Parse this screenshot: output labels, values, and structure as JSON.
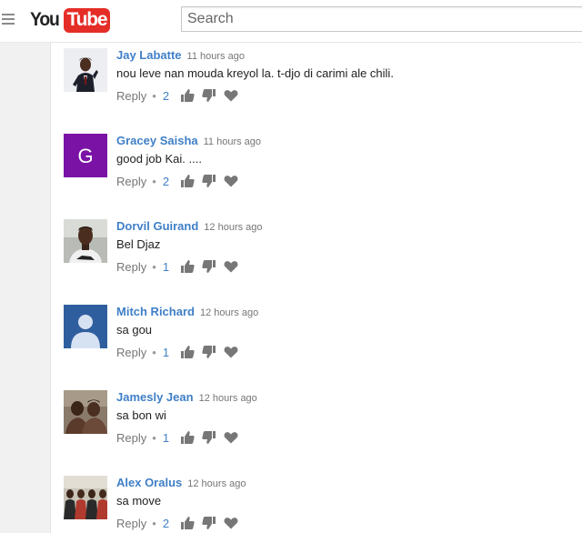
{
  "header": {
    "logo_you": "You",
    "logo_tube": "Tube",
    "search_placeholder": "Search"
  },
  "colors": {
    "author_link": "#3f7fc7",
    "logo_red": "#e52d27",
    "meta_gray": "#767676",
    "icon_gray": "#777777"
  },
  "comments": [
    {
      "author": "Jay Labatte",
      "time": "11 hours ago",
      "text": "nou leve nan mouda kreyol la. t-djo di carimi ale chili.",
      "reply_label": "Reply",
      "separator": "•",
      "likes": "2",
      "avatar": "photo-man-in-suit-icon"
    },
    {
      "author": "Gracey Saisha",
      "time": "11 hours ago",
      "text": "good job Kai. ....",
      "reply_label": "Reply",
      "separator": "•",
      "likes": "2",
      "avatar": "letter-avatar-icon",
      "avatar_letter": "G",
      "avatar_color": "#7b12a6"
    },
    {
      "author": "Dorvil Guirand",
      "time": "12 hours ago",
      "text": "Bel Djaz",
      "reply_label": "Reply",
      "separator": "•",
      "likes": "1",
      "avatar": "photo-man-portrait-icon"
    },
    {
      "author": "Mitch Richard",
      "time": "12 hours ago",
      "text": "sa gou",
      "reply_label": "Reply",
      "separator": "•",
      "likes": "1",
      "avatar": "default-user-silhouette-icon",
      "avatar_color": "#2f5e9e"
    },
    {
      "author": "Jamesly Jean",
      "time": "12 hours ago",
      "text": "sa bon wi",
      "reply_label": "Reply",
      "separator": "•",
      "likes": "1",
      "avatar": "photo-two-people-icon"
    },
    {
      "author": "Alex Oralus",
      "time": "12 hours ago",
      "text": "sa move",
      "reply_label": "Reply",
      "separator": "•",
      "likes": "2",
      "avatar": "photo-group-people-icon"
    }
  ]
}
